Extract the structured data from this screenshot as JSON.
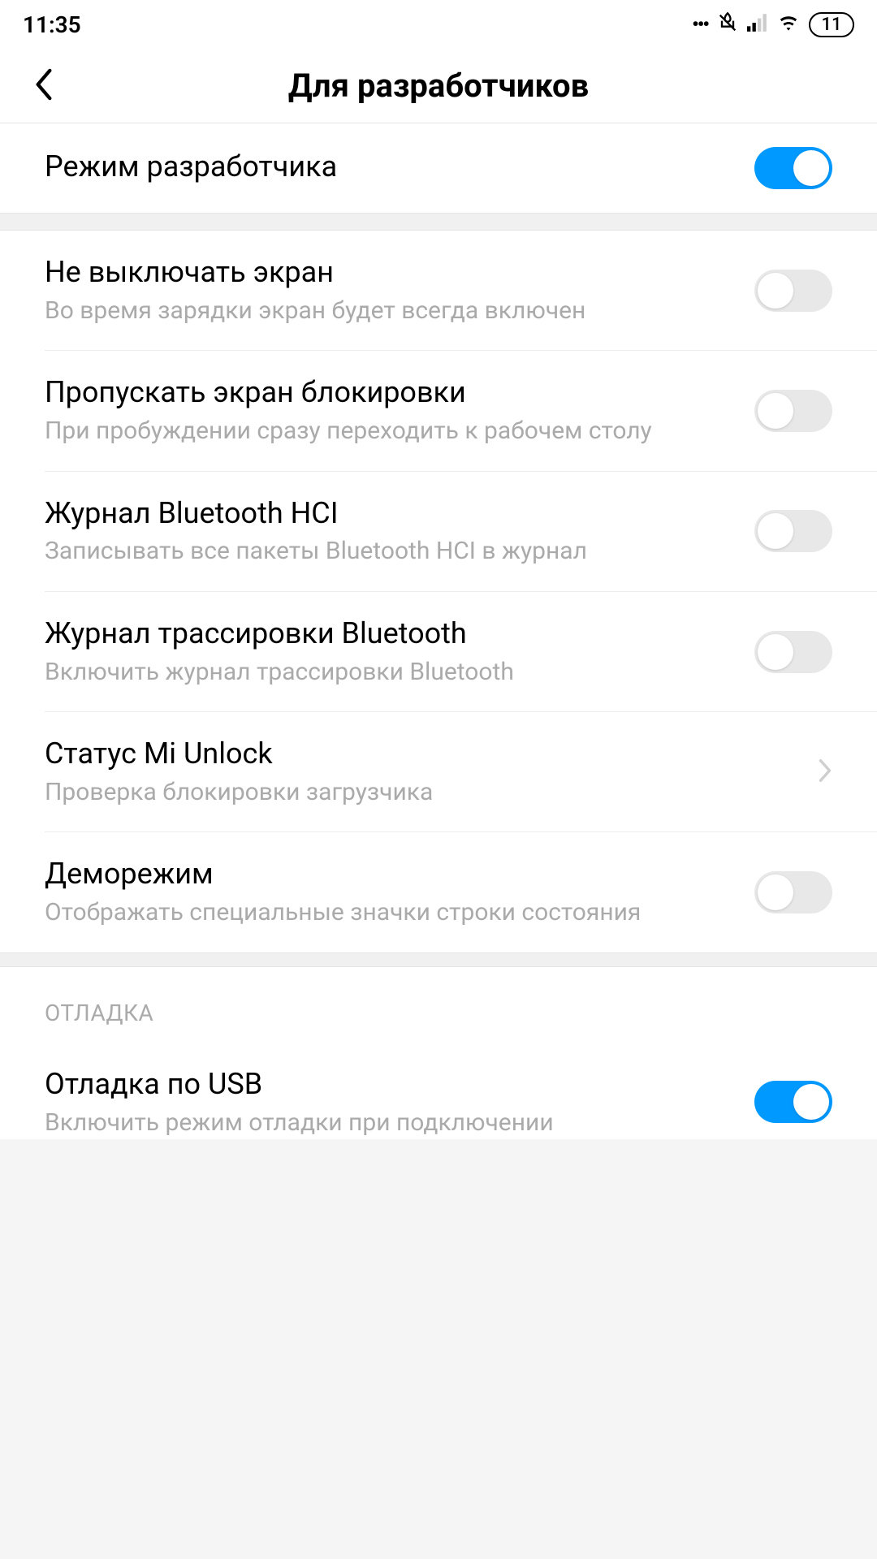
{
  "status": {
    "time": "11:35",
    "battery": "11"
  },
  "header": {
    "title": "Для разработчиков"
  },
  "rows": {
    "dev_mode": {
      "title": "Режим разработчика",
      "on": true
    },
    "stay_awake": {
      "title": "Не выключать экран",
      "sub": "Во время зарядки экран будет всегда включен",
      "on": false
    },
    "skip_lock": {
      "title": "Пропускать экран блокировки",
      "sub": "При пробуждении сразу переходить к рабочем столу",
      "on": false
    },
    "bt_hci": {
      "title": "Журнал Bluetooth HCI",
      "sub": "Записывать все пакеты Bluetooth HCI в журнал",
      "on": false
    },
    "bt_trace": {
      "title": "Журнал трассировки Bluetooth",
      "sub": "Включить журнал трассировки Bluetooth",
      "on": false
    },
    "mi_unlock": {
      "title": "Статус Mi Unlock",
      "sub": "Проверка блокировки загрузчика"
    },
    "demo": {
      "title": "Деморежим",
      "sub": "Отображать специальные значки строки состояния",
      "on": false
    },
    "debug_section": "ОТЛАДКА",
    "usb_debug": {
      "title": "Отладка по USB",
      "sub": "Включить режим отладки при подключении",
      "on": true
    }
  }
}
